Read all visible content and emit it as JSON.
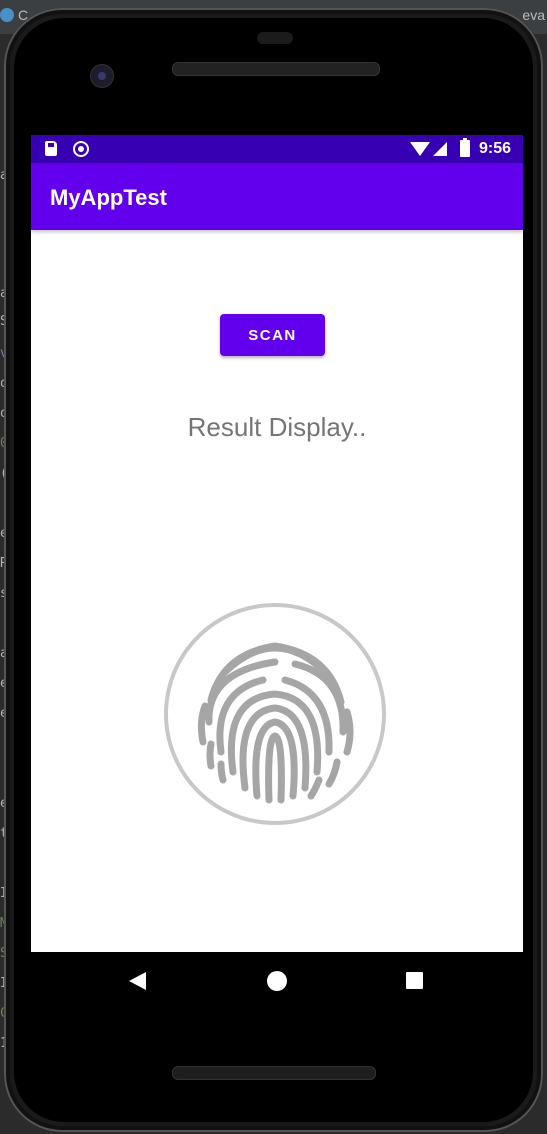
{
  "ide": {
    "tab_left": "C",
    "tab_right": "eva",
    "gutter_chars": [
      "a",
      "",
      "a",
      "S",
      "v",
      "o",
      "o",
      "0",
      "(",
      "",
      "e",
      "R",
      "s",
      "",
      "a",
      "e",
      "e",
      "",
      "",
      "e",
      "t",
      "",
      "I",
      "M",
      "S",
      "I",
      "C",
      "1"
    ]
  },
  "status_bar": {
    "time": "9:56",
    "icons": [
      "sd-card-icon",
      "sync-circle-icon",
      "wifi-icon",
      "signal-icon",
      "battery-icon"
    ]
  },
  "app_bar": {
    "title": "MyAppTest"
  },
  "main": {
    "scan_button_label": "SCAN",
    "result_text": "Result Display..",
    "fingerprint_icon": "fingerprint-icon"
  },
  "nav_bar": {
    "buttons": [
      "back-icon",
      "home-icon",
      "recents-icon"
    ]
  },
  "colors": {
    "primary": "#6200ee",
    "primary_dark": "#3700b3",
    "result_text": "#757575",
    "fingerprint": "#9e9e9e"
  }
}
